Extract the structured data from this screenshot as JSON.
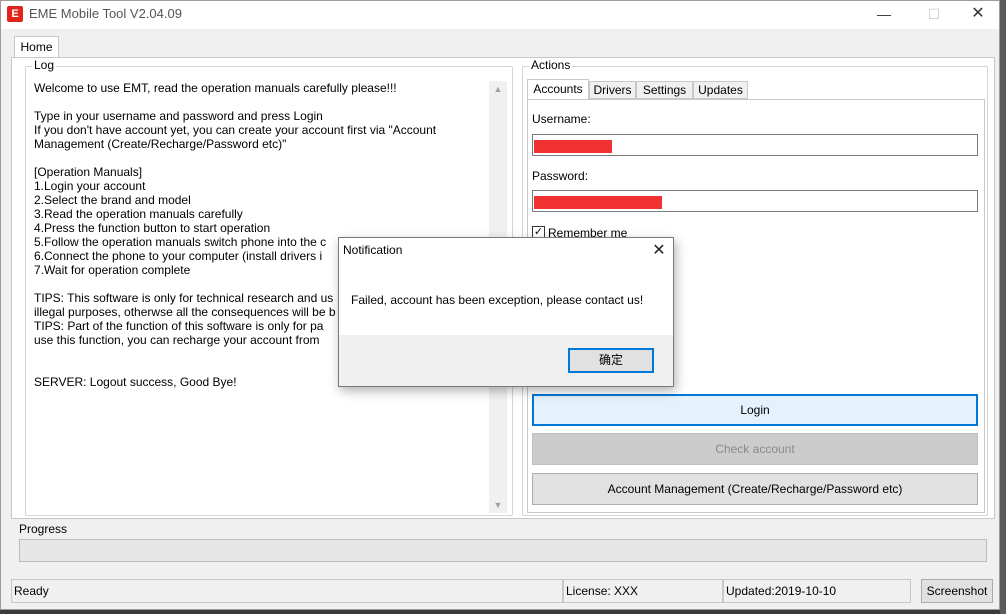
{
  "window": {
    "title": "EME Mobile Tool V2.04.09",
    "icon_glyph": "E",
    "controls": {
      "minimize": "—",
      "maximize": "☐",
      "close": "✕"
    }
  },
  "main_tab": {
    "label": "Home"
  },
  "log": {
    "label": "Log",
    "text": "Welcome to use EMT, read the operation manuals carefully please!!!\n\nType in your username and password and press Login\nIf you don't have account yet, you can create your account first via \"Account Management (Create/Recharge/Password etc)\"\n\n[Operation Manuals]\n1.Login your account\n2.Select the brand and model\n3.Read the operation manuals carefully\n4.Press the function button to start operation\n5.Follow the operation manuals switch phone into the c\n6.Connect the phone to your computer (install drivers i\n7.Wait for operation complete\n\nTIPS: This software is only for technical research and us\nillegal purposes, otherwse all the consequences will be b\nTIPS: Part of the function of this software is only for pa\nuse this function, you can recharge your account from \n\n\nSERVER: Logout success, Good Bye!",
    "scroll_up_glyph": "▲",
    "scroll_down_glyph": "▼"
  },
  "actions": {
    "label": "Actions",
    "tabs": [
      {
        "label": "Accounts"
      },
      {
        "label": "Drivers"
      },
      {
        "label": "Settings"
      },
      {
        "label": "Updates"
      }
    ],
    "username_label": "Username:",
    "password_label": "Password:",
    "remember_label": "Remember me",
    "remember_checked": true,
    "check_glyph": "✓",
    "redaction_color": "#f03232",
    "login_label": "Login",
    "check_account_label": "Check account",
    "account_management_label": "Account Management (Create/Recharge/Password etc)"
  },
  "progress": {
    "label": "Progress",
    "value": 0
  },
  "status": {
    "state": "Ready",
    "license": "License: XXX",
    "updated": "Updated:2019-10-10",
    "screenshot_label": "Screenshot"
  },
  "dialog": {
    "title": "Notification",
    "close_glyph": "✕",
    "message": "Failed, account has been exception, please contact us!",
    "ok_label": "确定"
  },
  "colors": {
    "accent_focus": "#0078d7",
    "app_icon_red": "#e2231a",
    "progress_green": "#06b025"
  }
}
